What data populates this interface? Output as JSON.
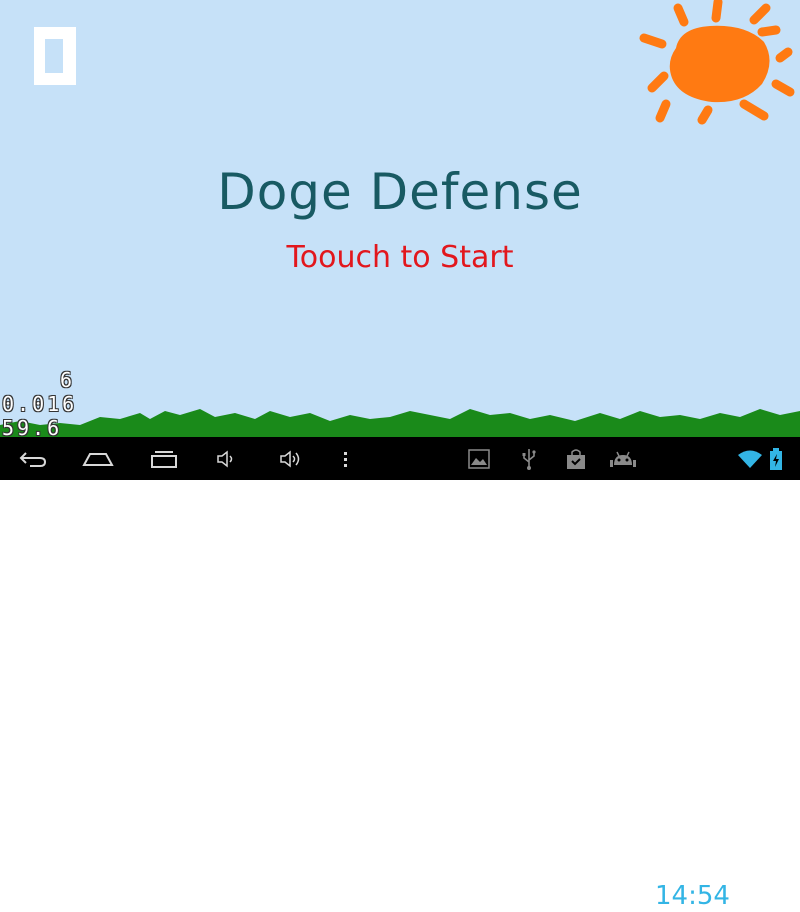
{
  "game": {
    "title": "Doge Defense",
    "start_prompt": "Toouch to Start"
  },
  "debug": {
    "line1": "6",
    "line2": "0.016",
    "line3": "59.6"
  },
  "status_bar": {
    "time": "14:54"
  },
  "colors": {
    "sky": "#c6e1f8",
    "title": "#185a63",
    "start_prompt": "#e2171d",
    "sun": "#ff7a12",
    "grass": "#1a8a1a",
    "clock": "#33b5e5"
  },
  "icons": [
    "pause-icon",
    "sun-icon",
    "back-icon",
    "home-icon",
    "recent-apps-icon",
    "volume-down-icon",
    "volume-up-icon",
    "menu-icon",
    "gallery-icon",
    "usb-icon",
    "shopping-bag-icon",
    "android-icon",
    "wifi-icon",
    "battery-icon"
  ]
}
